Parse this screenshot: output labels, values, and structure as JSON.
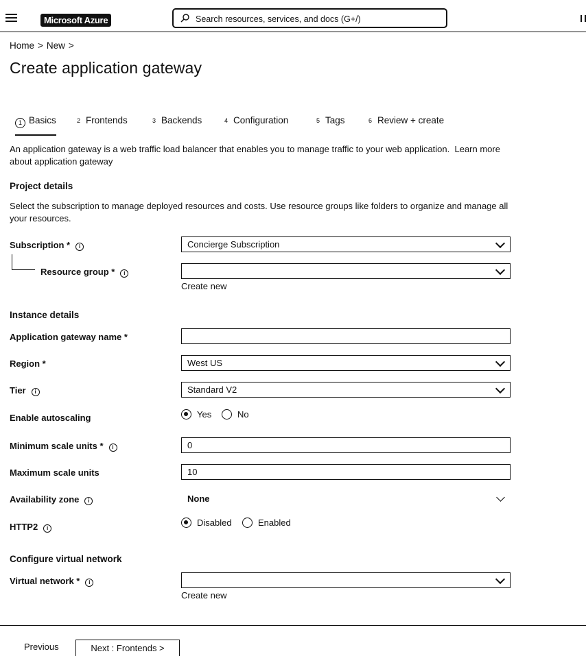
{
  "header": {
    "brand": "Microsoft Azure",
    "search_placeholder": "Search resources, services, and docs (G+/)"
  },
  "breadcrumb": [
    "Home",
    "New"
  ],
  "page_title": "Create application gateway",
  "tabs": [
    {
      "num": "1",
      "label": "Basics",
      "active": true
    },
    {
      "num": "2",
      "label": "Frontends"
    },
    {
      "num": "3",
      "label": "Backends"
    },
    {
      "num": "4",
      "label": "Configuration"
    },
    {
      "num": "5",
      "label": "Tags"
    },
    {
      "num": "6",
      "label": "Review + create"
    }
  ],
  "intro": {
    "text": "An application gateway is a web traffic load balancer that enables you to manage traffic to your web application.",
    "link": "Learn more about application gateway"
  },
  "project": {
    "heading": "Project details",
    "description": "Select the subscription to manage deployed resources and costs. Use resource groups like folders to organize and manage all your resources.",
    "subscription_label": "Subscription *",
    "subscription_value": "Concierge Subscription",
    "resource_group_label": "Resource group *",
    "resource_group_value": "",
    "create_new": "Create new"
  },
  "instance": {
    "heading": "Instance details",
    "name_label": "Application gateway name *",
    "name_value": "",
    "region_label": "Region *",
    "region_value": "West US",
    "tier_label": "Tier",
    "tier_value": "Standard V2",
    "autoscaling_label": "Enable autoscaling",
    "autoscaling_options": [
      "Yes",
      "No"
    ],
    "autoscaling_selected": "Yes",
    "min_label": "Minimum scale units *",
    "min_value": "0",
    "max_label": "Maximum scale units",
    "max_value": "10",
    "zone_label": "Availability zone",
    "zone_value": "None",
    "http2_label": "HTTP2",
    "http2_options": [
      "Disabled",
      "Enabled"
    ],
    "http2_selected": "Disabled"
  },
  "network": {
    "heading": "Configure virtual network",
    "vnet_label": "Virtual network *",
    "vnet_value": "",
    "create_new": "Create new"
  },
  "footer": {
    "previous": "Previous",
    "next": "Next : Frontends >"
  },
  "icons": [
    "menu-icon",
    "search-icon",
    "info-icon",
    "chevron-down-icon"
  ]
}
